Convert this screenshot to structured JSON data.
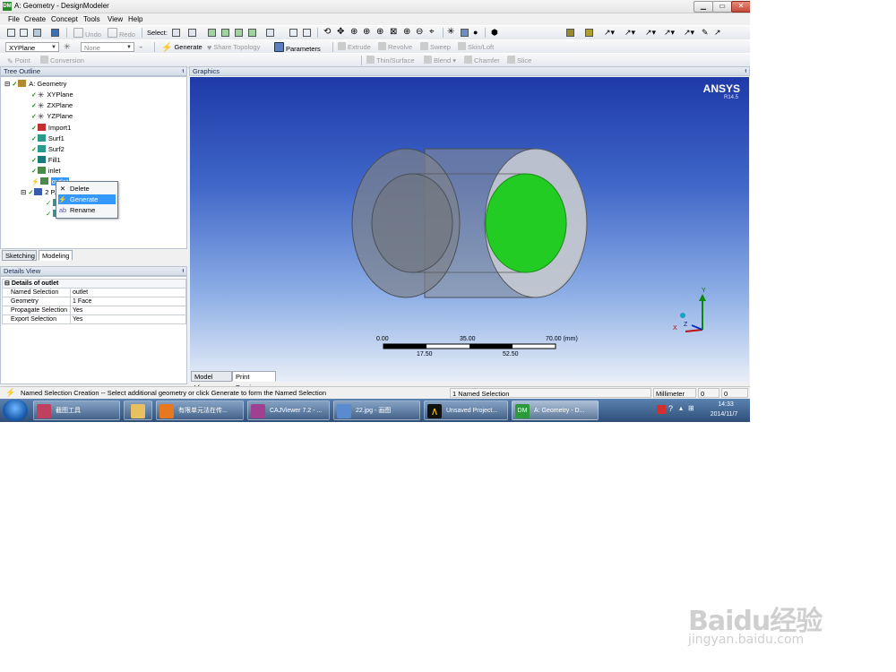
{
  "window": {
    "title": "A: Geometry - DesignModeler",
    "min": "▁",
    "max": "▭",
    "close": "✕",
    "app_icon": "DM"
  },
  "menu": [
    "File",
    "Create",
    "Concept",
    "Tools",
    "View",
    "Help"
  ],
  "toolbar1": {
    "select_label": "Select:",
    "undo": "Undo",
    "redo": "Redo",
    "icons": [
      "new-icon",
      "save-icon",
      "export-icon",
      "screenshot-icon",
      "select-mode-icon",
      "rotate-icon",
      "pan-icon",
      "zoom-icon",
      "zoom-box-icon",
      "zoom-fit-icon",
      "look-at-icon"
    ]
  },
  "toolbar2": {
    "plane": "XYPlane",
    "sketch": "None",
    "generate": "Generate",
    "share_topology": "Share Topology",
    "parameters": "Parameters",
    "extrude": "Extrude",
    "revolve": "Revolve",
    "sweep": "Sweep",
    "skin_loft": "Skin/Loft"
  },
  "toolbar3": {
    "point": "Point",
    "conversion": "Conversion",
    "thin_surface": "Thin/Surface",
    "blend": "Blend",
    "chamfer": "Chamfer",
    "slice": "Slice"
  },
  "tree": {
    "title": "Tree Outline",
    "root": "A: Geometry",
    "items": [
      "XYPlane",
      "ZXPlane",
      "YZPlane",
      "Import1",
      "Surf1",
      "Surf2",
      "Fill1",
      "inlet",
      "outlet",
      "2 P..."
    ],
    "tabs": [
      "Sketching",
      "Modeling"
    ]
  },
  "context_menu": [
    "Delete",
    "Generate",
    "Rename"
  ],
  "details": {
    "title": "Details View",
    "header": "Details of outlet",
    "rows": [
      {
        "k": "Named Selection",
        "v": "outlet"
      },
      {
        "k": "Geometry",
        "v": "1 Face"
      },
      {
        "k": "Propagate Selection",
        "v": "Yes"
      },
      {
        "k": "Export Selection",
        "v": "Yes"
      }
    ]
  },
  "graphics": {
    "title": "Graphics",
    "brand": "ANSYS",
    "version": "R14.5",
    "scale_top": [
      "0.00",
      "35.00",
      "70.00 (mm)"
    ],
    "scale_bottom": [
      "17.50",
      "52.50"
    ],
    "axis_y": "Y",
    "axis_x": "X",
    "axis_z": "Z",
    "tabs": [
      "Model View",
      "Print Preview"
    ],
    "highlight_color": "#22cc22"
  },
  "status": {
    "message": "Named Selection Creation -- Select additional geometry or click Generate to form the Named Selection",
    "selection": "1 Named Selection",
    "units": "Millimeter",
    "v1": "0",
    "v2": "0"
  },
  "taskbar": {
    "buttons": [
      "截图工具",
      "",
      "有限单元法在传...",
      "CAJViewer 7.2 - ...",
      "22.jpg - 画图",
      "Unsaved Project...",
      "A: Geometry - D..."
    ],
    "time": "14:33",
    "date": "2014/11/7"
  },
  "watermark": {
    "line1": "Baidu经验",
    "line2": "jingyan.baidu.com"
  }
}
